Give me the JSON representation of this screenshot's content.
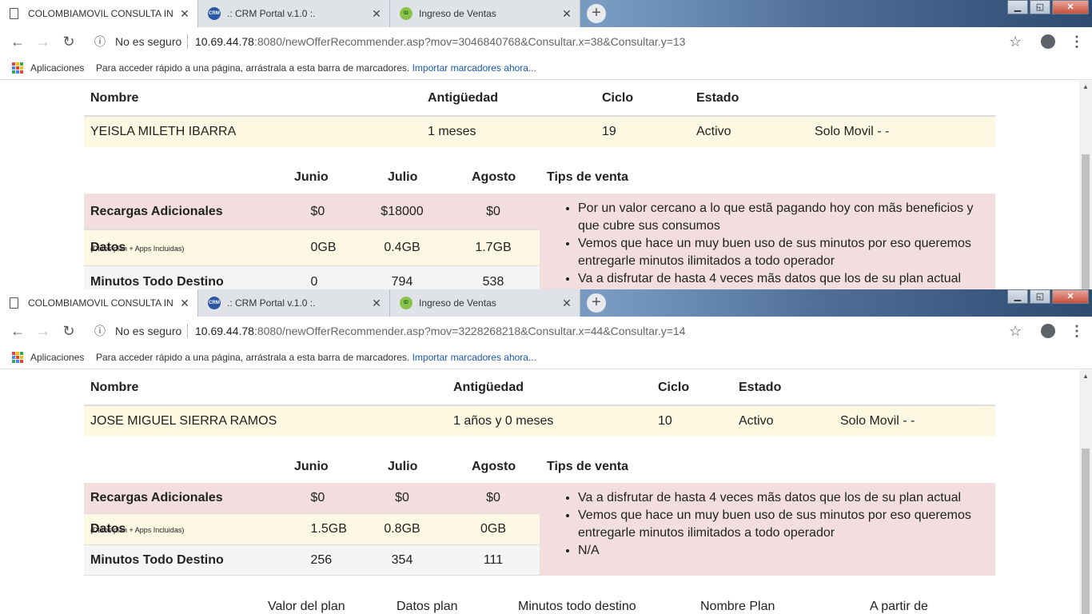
{
  "browser": {
    "tabs": [
      {
        "label": "COLOMBIAMOVIL CONSULTA IN",
        "icon": "page-icon"
      },
      {
        "label": ".: CRM Portal v.1.0 :.",
        "icon": "crm-icon"
      },
      {
        "label": "Ingreso de Ventas",
        "icon": "ingreso-icon"
      }
    ],
    "tab_close": "✕",
    "new_tab": "+",
    "security_label": "No es seguro",
    "bookmarks_apps": "Aplicaciones",
    "bookmarks_hint": "Para acceder rápido a una página, arrástrala a esta barra de marcadores.",
    "bookmarks_import": "Importar marcadores ahora..."
  },
  "window1": {
    "url_host": "10.69.44.78",
    "url_rest": ":8080/newOfferRecommender.asp?mov=3046840768&Consultar.x=38&Consultar.y=13",
    "client_headers": {
      "nombre": "Nombre",
      "antiguedad": "Antigüedad",
      "ciclo": "Ciclo",
      "estado": "Estado"
    },
    "client": {
      "nombre": "YEISLA MILETH IBARRA",
      "antiguedad": "1 meses",
      "ciclo": "19",
      "estado": "Activo",
      "tipo": "Solo Movil - -"
    },
    "month_headers": [
      "Junio",
      "Julio",
      "Agosto"
    ],
    "tips_header": "Tips de venta",
    "rows": [
      {
        "label": "Recargas Adicionales",
        "note": "",
        "values": [
          "$0",
          "$18000",
          "$0"
        ]
      },
      {
        "label": "Datos",
        "note": "(Datos plan + Apps Incluidas)",
        "values": [
          "0GB",
          "0.4GB",
          "1.7GB"
        ]
      },
      {
        "label": "Minutos Todo Destino",
        "note": "",
        "values": [
          "0",
          "794",
          "538"
        ]
      }
    ],
    "tips": [
      "Por un valor cercano a lo que estã pagando hoy con mãs beneficios y que cubre sus consumos",
      "Vemos que hace un muy buen uso de sus minutos por eso queremos entregarle minutos ilimitados a todo operador",
      "Va a disfrutar de hasta 4 veces mãs datos que los de su plan actual"
    ]
  },
  "window2": {
    "url_host": "10.69.44.78",
    "url_rest": ":8080/newOfferRecommender.asp?mov=3228268218&Consultar.x=44&Consultar.y=14",
    "client_headers": {
      "nombre": "Nombre",
      "antiguedad": "Antigüedad",
      "ciclo": "Ciclo",
      "estado": "Estado"
    },
    "client": {
      "nombre": "JOSE MIGUEL SIERRA RAMOS",
      "antiguedad": "1 años y 0 meses",
      "ciclo": "10",
      "estado": "Activo",
      "tipo": "Solo Movil - -"
    },
    "month_headers": [
      "Junio",
      "Julio",
      "Agosto"
    ],
    "tips_header": "Tips de venta",
    "rows": [
      {
        "label": "Recargas Adicionales",
        "note": "",
        "values": [
          "$0",
          "$0",
          "$0"
        ]
      },
      {
        "label": "Datos",
        "note": "(Datos plan + Apps Incluidas)",
        "values": [
          "1.5GB",
          "0.8GB",
          "0GB"
        ]
      },
      {
        "label": "Minutos Todo Destino",
        "note": "",
        "values": [
          "256",
          "354",
          "111"
        ]
      }
    ],
    "tips": [
      "Va a disfrutar de hasta 4 veces mãs datos que los de su plan actual",
      "Vemos que hace un muy buen uso de sus minutos por eso queremos entregarle minutos ilimitados a todo operador",
      "N/A"
    ],
    "plan_headers": [
      "Valor del plan",
      "Datos plan",
      "Minutos todo destino",
      "Nombre Plan",
      "A partir de"
    ]
  }
}
